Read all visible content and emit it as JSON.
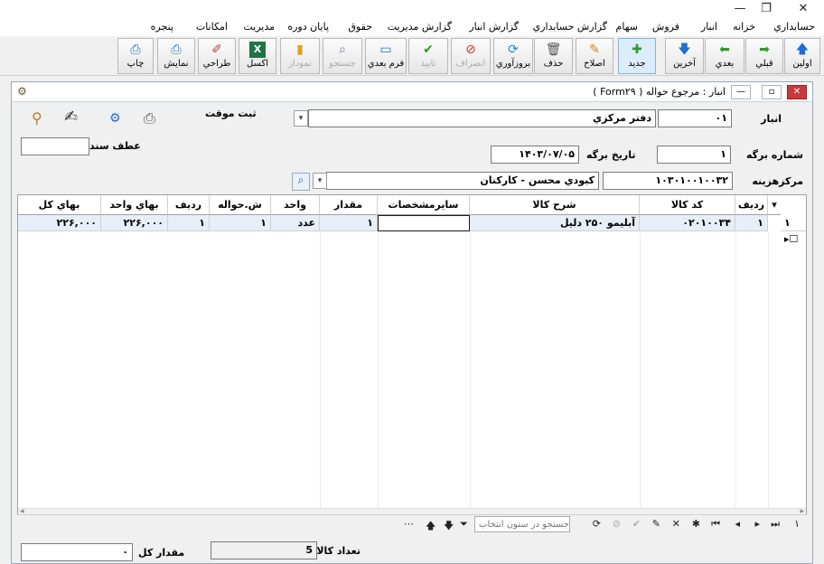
{
  "window": {
    "close": "✕",
    "restore": "❐",
    "minimize": "—"
  },
  "menu": [
    "حسابداري",
    "خزانه",
    "انبار",
    "فروش",
    "سهام",
    "گزارش حسابداري",
    "گزارش انبار",
    "گزارش مديريت",
    "حقوق",
    "پايان دوره",
    "مديريت",
    "امكانات",
    "پنجره"
  ],
  "toolbar": [
    {
      "label": "اولين",
      "icon": "🡅",
      "state": "normal"
    },
    {
      "label": "قبلي",
      "icon": "➡",
      "state": "normal"
    },
    {
      "label": "بعدي",
      "icon": "⬅",
      "state": "normal"
    },
    {
      "label": "آخرين",
      "icon": "🡇",
      "state": "normal"
    },
    {
      "label": "جديد",
      "icon": "✚",
      "state": "active"
    },
    {
      "label": "اصلاح",
      "icon": "✎",
      "state": "normal"
    },
    {
      "label": "حذف",
      "icon": "🗑",
      "state": "normal"
    },
    {
      "label": "بروزآوري",
      "icon": "⟳",
      "state": "normal"
    },
    {
      "label": "انصراف",
      "icon": "⊘",
      "state": "disabled"
    },
    {
      "label": "تاييد",
      "icon": "✔",
      "state": "disabled"
    },
    {
      "label": "فرم بعدي",
      "icon": "▭",
      "state": "normal"
    },
    {
      "label": "جستجو",
      "icon": "⌕",
      "state": "disabled"
    },
    {
      "label": "نمودار",
      "icon": "▮",
      "state": "disabled"
    },
    {
      "label": "اكسل",
      "icon": "X",
      "state": "normal"
    },
    {
      "label": "طراحي",
      "icon": "✐",
      "state": "normal"
    },
    {
      "label": "نمايش",
      "icon": "⎙",
      "state": "normal"
    },
    {
      "label": "چاپ",
      "icon": "⎙",
      "state": "normal"
    }
  ],
  "form": {
    "title": "انبار : مرجوع حواله ( Form۲۹ )",
    "warehouse_label": "انبار",
    "warehouse_code": "۰۱",
    "warehouse_name": "دفتر مركزي",
    "temp_save": "ثبت موقت",
    "sheet_no_label": "شماره برگه",
    "sheet_no": "۱",
    "sheet_date_label": "تاريخ برگه",
    "sheet_date": "۱۴۰۳/۰۷/۰۵",
    "ref_doc_label": "عطف سند",
    "ref_doc": "",
    "cost_center_label": "مركزهزينه",
    "cost_center_code": "۱۰۳۰۱۰۰۱۰۰۳۲",
    "cost_center_name": "كبودي محسن - كاركنان"
  },
  "grid": {
    "headers": [
      "رديف",
      "كد كالا",
      "شرح كالا",
      "سايرمشخصات",
      "مقدار",
      "واحد",
      "ش.حواله",
      "رديف",
      "بهاي واحد",
      "بهاي كل"
    ],
    "rows": [
      {
        "rownum": "۱",
        "row": "۱",
        "code": "۰۲۰۱۰۰۳۴",
        "desc": "آبليمو ۲۵۰ دليل",
        "other": "",
        "qty": "۱",
        "unit": "عدد",
        "ref": "۱",
        "row2": "۱",
        "unit_price": "۲۲۶,۰۰۰",
        "total": "۲۲۶,۰۰۰"
      }
    ]
  },
  "nav": {
    "record": "۱",
    "search_placeholder": "جستجو در ستون انتخاب"
  },
  "footer": {
    "items_label": "تعداد كالا",
    "items_count": "5",
    "total_qty_label": "مقدار كل",
    "total_qty": "۰"
  }
}
